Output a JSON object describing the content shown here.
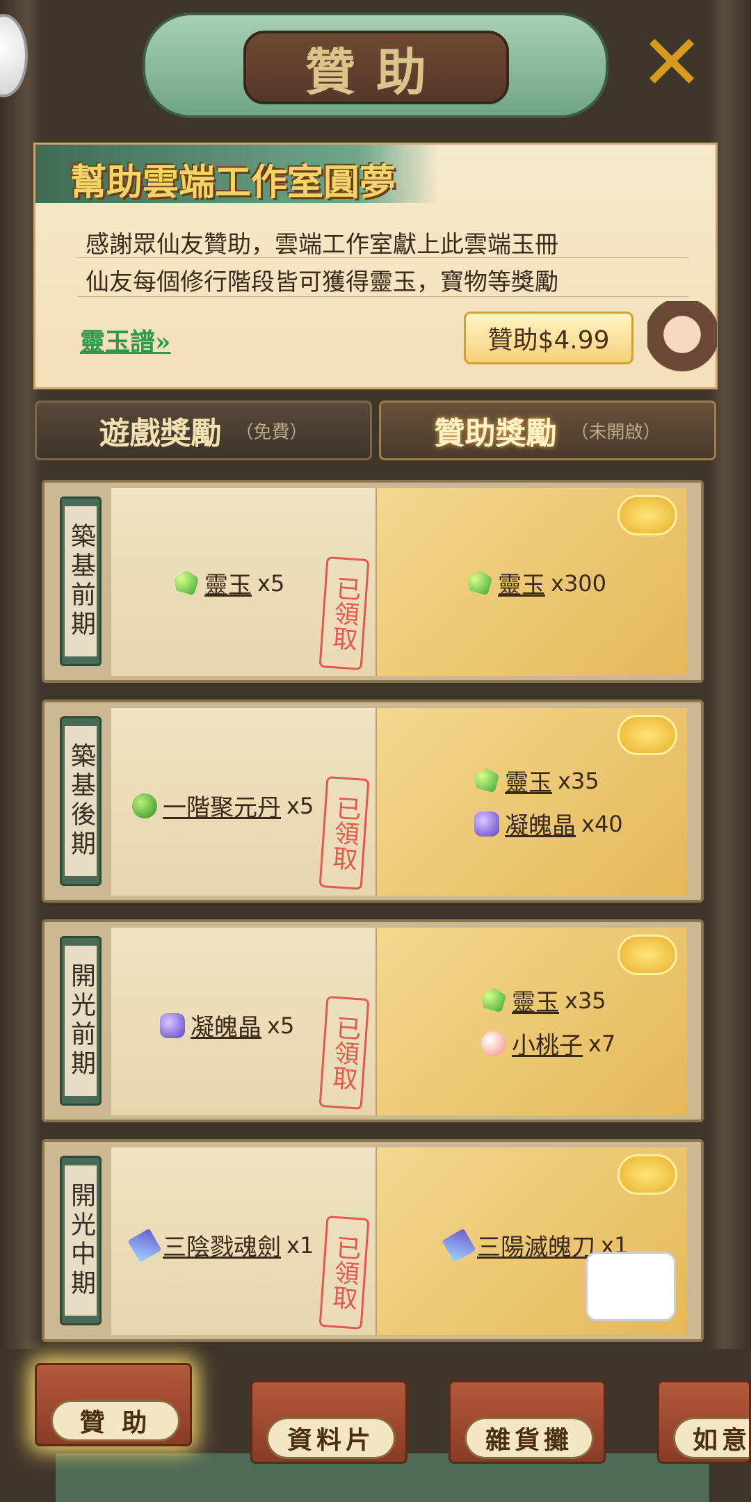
{
  "header": {
    "title": "贊助",
    "close_icon": "close-icon"
  },
  "banner": {
    "title": "幫助雲端工作室圓夢",
    "line1": "感謝眾仙友贊助，雲端工作室獻上此雲端玉冊",
    "line2": "仙友每個修行階段皆可獲得靈玉，寶物等獎勵",
    "link": "靈玉譜",
    "sponsor_button": "贊助$4.99"
  },
  "tabs": [
    {
      "name": "遊戲獎勵",
      "note": "（免費）"
    },
    {
      "name": "贊助獎勵",
      "note": "（未開啟）"
    }
  ],
  "rows": [
    {
      "stage": "築基前期",
      "stamp": "已領取",
      "free": [
        {
          "icon": "jade-icon",
          "name": "靈玉",
          "count": "x5"
        }
      ],
      "paid": [
        {
          "icon": "jade-icon",
          "name": "靈玉",
          "count": "x300"
        }
      ]
    },
    {
      "stage": "築基後期",
      "stamp": "已領取",
      "free": [
        {
          "icon": "pill-icon",
          "name": "一階聚元丹",
          "count": "x5"
        }
      ],
      "paid": [
        {
          "icon": "jade-icon",
          "name": "靈玉",
          "count": "x35"
        },
        {
          "icon": "crystal-icon",
          "name": "凝魄晶",
          "count": "x40"
        }
      ]
    },
    {
      "stage": "開光前期",
      "stamp": "已領取",
      "free": [
        {
          "icon": "crystal-icon",
          "name": "凝魄晶",
          "count": "x5"
        }
      ],
      "paid": [
        {
          "icon": "jade-icon",
          "name": "靈玉",
          "count": "x35"
        },
        {
          "icon": "peach-icon",
          "name": "小桃子",
          "count": "x7"
        }
      ]
    },
    {
      "stage": "開光中期",
      "stamp": "已領取",
      "free": [
        {
          "icon": "sword-icon",
          "name": "三陰戮魂劍",
          "count": "x1"
        }
      ],
      "paid": [
        {
          "icon": "blade-icon",
          "name": "三陽滅魄刀",
          "count": "x1"
        }
      ]
    }
  ],
  "bottom_tabs": [
    "贊 助",
    "資料片",
    "雜貨攤",
    "如意"
  ]
}
